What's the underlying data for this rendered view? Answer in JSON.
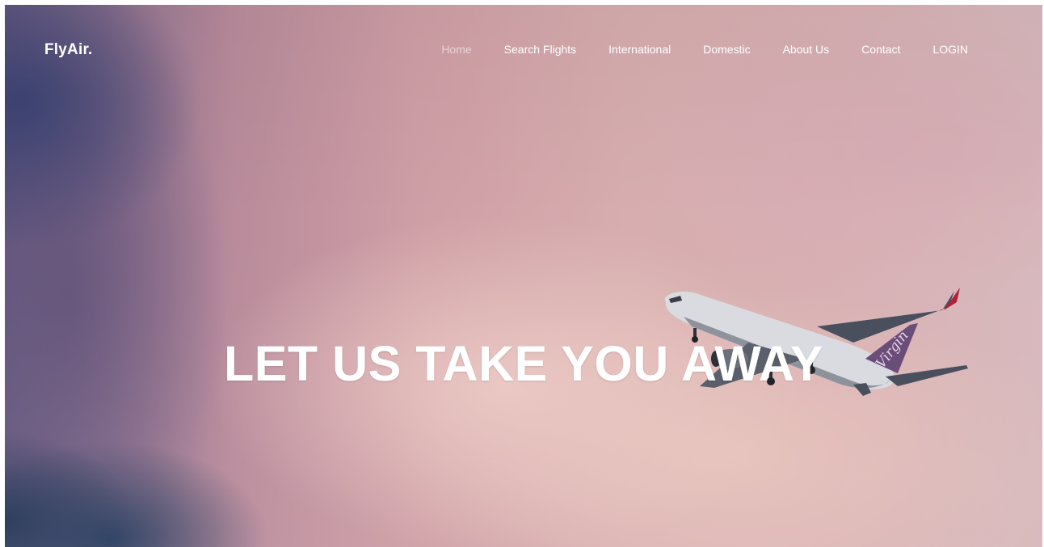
{
  "brand": {
    "name": "FlyAir."
  },
  "nav": {
    "items": [
      {
        "label": "Home",
        "active": true
      },
      {
        "label": "Search Flights",
        "active": false
      },
      {
        "label": "International",
        "active": false
      },
      {
        "label": "Domestic",
        "active": false
      },
      {
        "label": "About Us",
        "active": false
      },
      {
        "label": "Contact",
        "active": false
      },
      {
        "label": "LOGIN",
        "active": false
      }
    ]
  },
  "hero": {
    "headline": "LET US TAKE YOU AWAY",
    "plane_tail_text": "Virgin"
  },
  "colors": {
    "nav_text": "#ffffff",
    "nav_active": "#d9c7cc",
    "headline": "#ffffff",
    "sky_pink": "#d7adaf",
    "sky_blue": "#343e70"
  }
}
